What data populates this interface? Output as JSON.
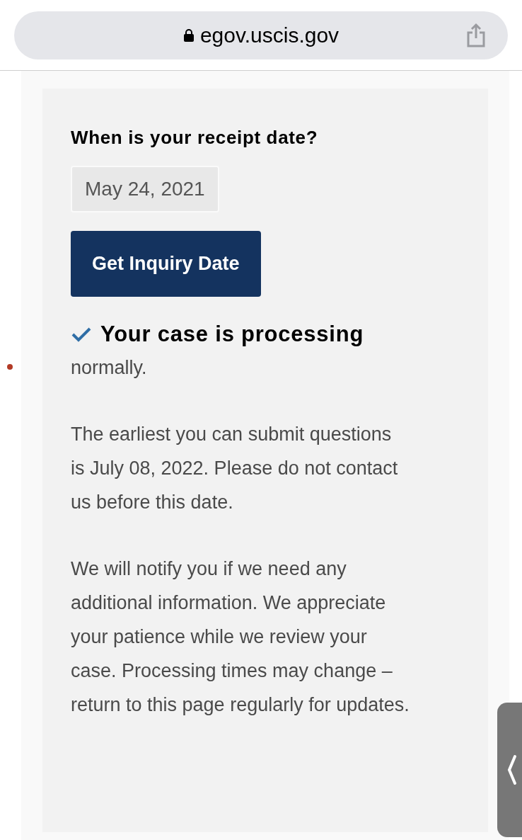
{
  "address_bar": {
    "url": "egov.uscis.gov"
  },
  "form": {
    "question": "When is your receipt date?",
    "date_value": "May 24, 2021",
    "button": "Get Inquiry Date"
  },
  "result": {
    "status": "Your case is processing",
    "status_continued": "normally.",
    "paragraphs": [
      "The earliest you can submit questions is July 08, 2022. Please do not contact us before this date.",
      "We will notify you if we need any additional information. We appreciate your patience while we review your case. Processing times may change – return to this page regularly for updates."
    ]
  }
}
